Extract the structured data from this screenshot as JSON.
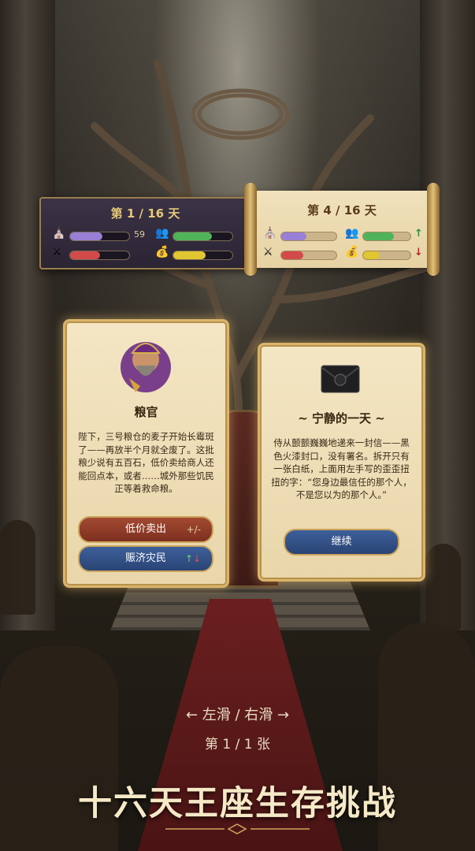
{
  "hud_current": {
    "day_label": "第 1 / 16 天",
    "faith_value": "59",
    "stats": {
      "faith": 0.55,
      "people": 0.65,
      "army": 0.5,
      "gold": 0.55
    }
  },
  "hud_preview": {
    "day_label": "第 4 / 16 天",
    "stats": {
      "faith": 0.45,
      "people": 0.65,
      "army": 0.4,
      "gold": 0.35
    },
    "people_trend": "↑",
    "gold_trend": "↓"
  },
  "card_left": {
    "name": "粮官",
    "text": "陛下，三号粮仓的麦子开始长霉斑了——再放半个月就全废了。这批粮少说有五百石，低价卖给商人还能回点本，或者……城外那些饥民正等着救命粮。",
    "option1": "低价卖出",
    "option1_hint": "+/-",
    "option2": "赈济灾民",
    "option2_hint_up": "↑",
    "option2_hint_down": "↓"
  },
  "card_right": {
    "title": "~ 宁静的一天 ~",
    "text": "侍从颤颤巍巍地递来一封信——黑色火漆封口，没有署名。拆开只有一张白纸，上面用左手写的歪歪扭扭的字：“您身边最信任的那个人，不是您以为的那个人。”",
    "continue": "继续"
  },
  "swipe_hint": "← 左滑 / 右滑 →",
  "page_indicator": "第 1 / 1 张",
  "slogan": "十六天王座生存挑战",
  "colors": {
    "faith": "#9a7fd6",
    "people": "#4fb35a",
    "army": "#d24a4a",
    "gold": "#e1c531"
  },
  "icons": [
    "church-icon",
    "people-icon",
    "swords-icon",
    "money-bag-icon",
    "envelope-icon",
    "advisor-portrait"
  ]
}
